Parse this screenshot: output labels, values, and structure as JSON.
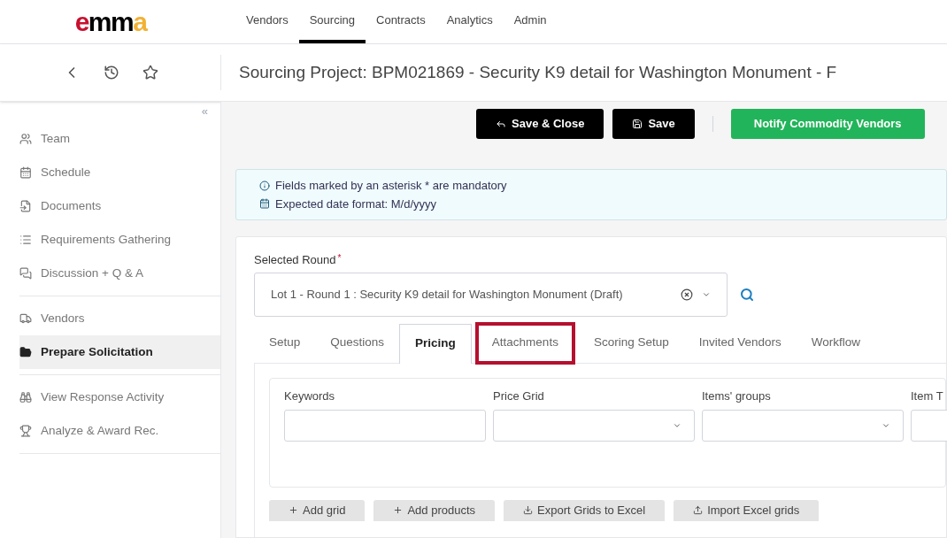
{
  "logo": {
    "text": "emma"
  },
  "top_nav": [
    {
      "label": "Vendors",
      "selected": false
    },
    {
      "label": "Sourcing",
      "selected": true
    },
    {
      "label": "Contracts",
      "selected": false
    },
    {
      "label": "Analytics",
      "selected": false
    },
    {
      "label": "Admin",
      "selected": false
    }
  ],
  "page_title": "Sourcing Project: BPM021869 - Security K9 detail for Washington Monument - F",
  "collapse_label": "«",
  "sidebar": {
    "sections": [
      [
        {
          "label": "Team",
          "kind": "users",
          "selected": false
        },
        {
          "label": "Schedule",
          "kind": "calendar",
          "selected": false
        },
        {
          "label": "Documents",
          "kind": "file",
          "selected": false
        },
        {
          "label": "Requirements Gathering",
          "kind": "list",
          "selected": false
        },
        {
          "label": "Discussion + Q & A",
          "kind": "chat",
          "selected": false
        }
      ],
      [
        {
          "label": "Vendors",
          "kind": "truck",
          "selected": false
        },
        {
          "label": "Prepare Solicitation",
          "kind": "folder",
          "selected": true
        }
      ],
      [
        {
          "label": "View Response Activity",
          "kind": "binoculars",
          "selected": false
        },
        {
          "label": "Analyze & Award Rec.",
          "kind": "trophy",
          "selected": false
        }
      ]
    ]
  },
  "actions": [
    {
      "label": "Save & Close",
      "kind": "dark"
    },
    {
      "label": "Save",
      "kind": "dark"
    },
    {
      "label": "Notify Commodity Vendors",
      "kind": "green"
    }
  ],
  "notice": [
    "Fields marked by an asterisk * are mandatory",
    "Expected date format: M/d/yyyy"
  ],
  "selected_round": {
    "label": "Selected Round",
    "required_mark": "*",
    "value": "Lot 1 - Round 1 : Security K9 detail for Washington Monument (Draft)"
  },
  "tabs": [
    {
      "label": "Setup",
      "selected": false,
      "highlighted": false
    },
    {
      "label": "Questions",
      "selected": false,
      "highlighted": false
    },
    {
      "label": "Pricing",
      "selected": true,
      "highlighted": false
    },
    {
      "label": "Attachments",
      "selected": false,
      "highlighted": true
    },
    {
      "label": "Scoring Setup",
      "selected": false,
      "highlighted": false
    },
    {
      "label": "Invited Vendors",
      "selected": false,
      "highlighted": false
    },
    {
      "label": "Workflow",
      "selected": false,
      "highlighted": false
    }
  ],
  "filters": [
    {
      "label": "Keywords",
      "kind": "text"
    },
    {
      "label": "Price Grid",
      "kind": "select"
    },
    {
      "label": "Items' groups",
      "kind": "select"
    },
    {
      "label": "Item T",
      "kind": "text"
    }
  ],
  "grid_buttons": [
    {
      "label": "Add grid",
      "kind": "add"
    },
    {
      "label": "Add products",
      "kind": "add"
    },
    {
      "label": "Export Grids to Excel",
      "kind": "export"
    },
    {
      "label": "Import Excel grids",
      "kind": "import"
    }
  ]
}
